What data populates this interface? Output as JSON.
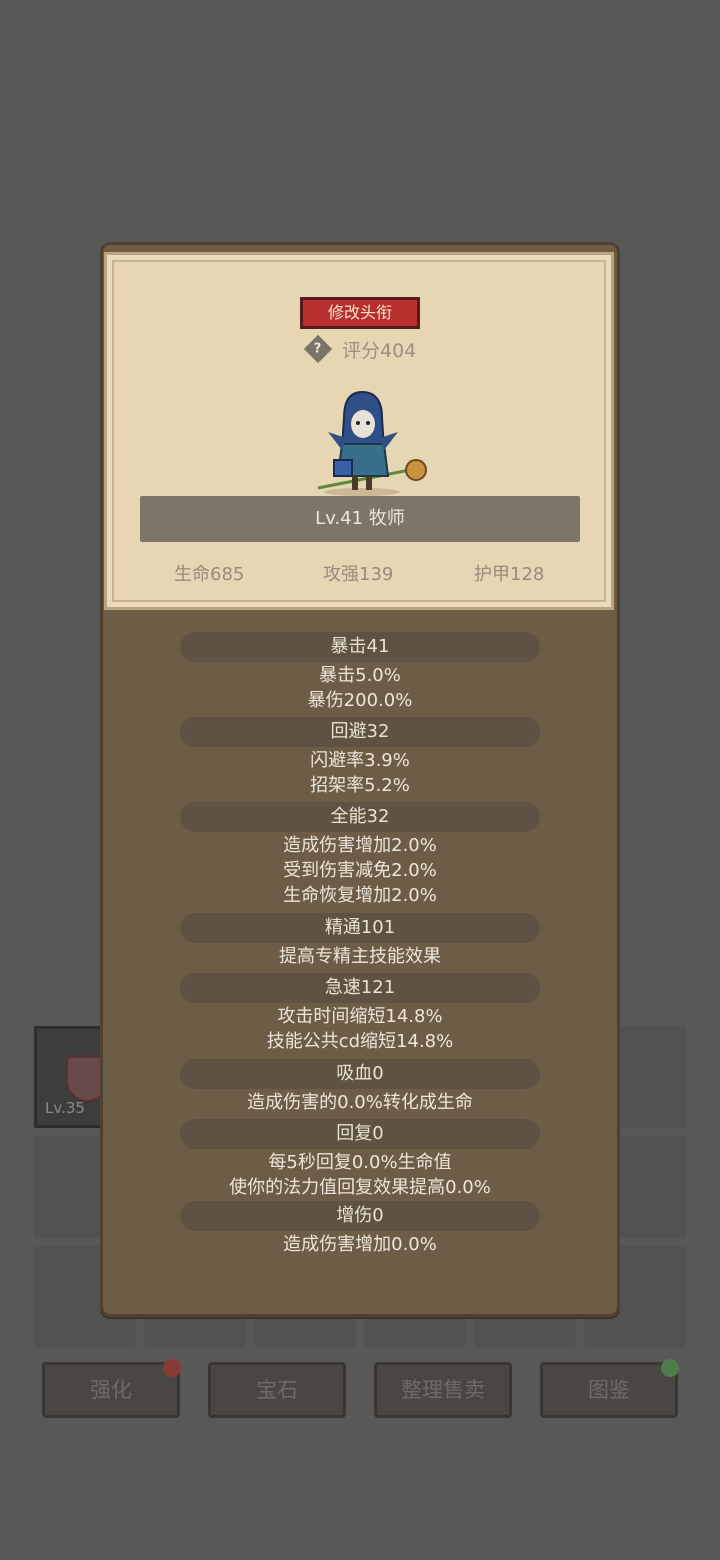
{
  "background": {
    "slot": {
      "level": "Lv.35",
      "icon": "shield-icon"
    },
    "buttons": [
      {
        "label": "强化",
        "badge": "red"
      },
      {
        "label": "宝石",
        "badge": null
      },
      {
        "label": "整理售卖",
        "badge": null
      },
      {
        "label": "图鉴",
        "badge": "green"
      }
    ]
  },
  "header": {
    "rename_button": "修改头衔",
    "help_icon": "question-icon",
    "score": "评分404",
    "level_class": "Lv.41 牧师",
    "basic_stats": {
      "hp": "生命685",
      "attack": "攻强139",
      "armor": "护甲128"
    }
  },
  "stats": [
    {
      "title": "暴击41",
      "lines": [
        "暴击5.0%",
        "暴伤200.0%"
      ]
    },
    {
      "title": "回避32",
      "lines": [
        "闪避率3.9%",
        "招架率5.2%"
      ]
    },
    {
      "title": "全能32",
      "lines": [
        "造成伤害增加2.0%",
        "受到伤害减免2.0%",
        "生命恢复增加2.0%"
      ]
    },
    {
      "title": "精通101",
      "lines": [
        "提高专精主技能效果"
      ]
    },
    {
      "title": "急速121",
      "lines": [
        "攻击时间缩短14.8%",
        "技能公共cd缩短14.8%"
      ]
    },
    {
      "title": "吸血0",
      "lines": [
        "造成伤害的0.0%转化成生命"
      ]
    },
    {
      "title": "回复0",
      "lines": [
        "每5秒回复0.0%生命值",
        "使你的法力值回复效果提高0.0%"
      ]
    },
    {
      "title": "增伤0",
      "lines": [
        "造成伤害增加0.0%"
      ]
    }
  ],
  "colors": {
    "accent_red": "#b8302d",
    "panel": "#6e5d46",
    "parchment": "#e6d6b4"
  }
}
